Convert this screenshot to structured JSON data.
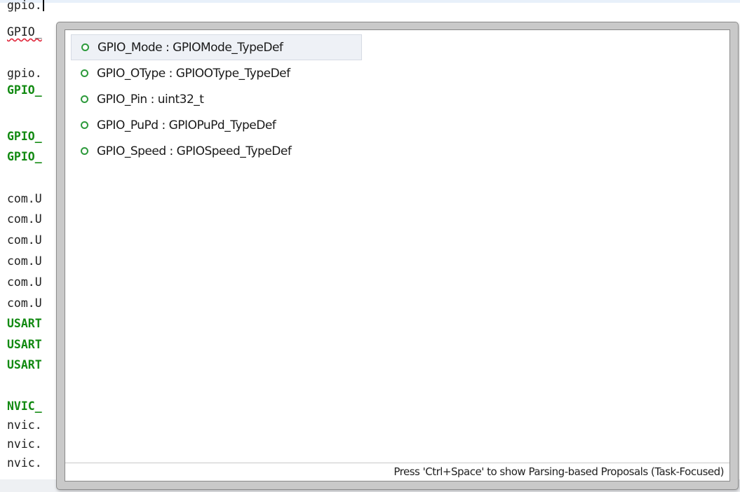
{
  "editor": {
    "lines": [
      {
        "text": "gpio.",
        "style": "plain",
        "caret": true
      },
      {
        "text": "GPIO_",
        "style": "plain",
        "error": true
      },
      {
        "text": "",
        "style": "plain"
      },
      {
        "text": "gpio.",
        "style": "plain"
      },
      {
        "text": "GPIO_",
        "style": "green"
      },
      {
        "text": "",
        "style": "plain"
      },
      {
        "text": "GPIO_",
        "style": "green"
      },
      {
        "text": "GPIO_",
        "style": "green"
      },
      {
        "text": "",
        "style": "plain"
      },
      {
        "text": "com.U",
        "style": "plain"
      },
      {
        "text": "com.U",
        "style": "plain"
      },
      {
        "text": "com.U",
        "style": "plain"
      },
      {
        "text": "com.U",
        "style": "plain"
      },
      {
        "text": "com.U",
        "style": "plain"
      },
      {
        "text": "com.U",
        "style": "plain"
      },
      {
        "text": "USART",
        "style": "green"
      },
      {
        "text": "USART",
        "style": "green"
      },
      {
        "text": "USART",
        "style": "green"
      },
      {
        "text": "",
        "style": "plain"
      },
      {
        "text": "NVIC_",
        "style": "green"
      },
      {
        "text": "nvic.",
        "style": "plain"
      },
      {
        "text": "nvic.",
        "style": "plain"
      },
      {
        "text": "nvic.",
        "style": "plain"
      }
    ]
  },
  "content_assist": {
    "proposals": [
      {
        "label": "GPIO_Mode : GPIOMode_TypeDef",
        "icon": "field-icon",
        "selected": true
      },
      {
        "label": "GPIO_OType : GPIOOType_TypeDef",
        "icon": "field-icon",
        "selected": false
      },
      {
        "label": "GPIO_Pin : uint32_t",
        "icon": "field-icon",
        "selected": false
      },
      {
        "label": "GPIO_PuPd : GPIOPuPd_TypeDef",
        "icon": "field-icon",
        "selected": false
      },
      {
        "label": "GPIO_Speed : GPIOSpeed_TypeDef",
        "icon": "field-icon",
        "selected": false
      }
    ],
    "status_text": "Press 'Ctrl+Space' to show Parsing-based Proposals (Task-Focused)",
    "icon_color": "#2d9a3c",
    "selection_color": "#eef1f6"
  }
}
